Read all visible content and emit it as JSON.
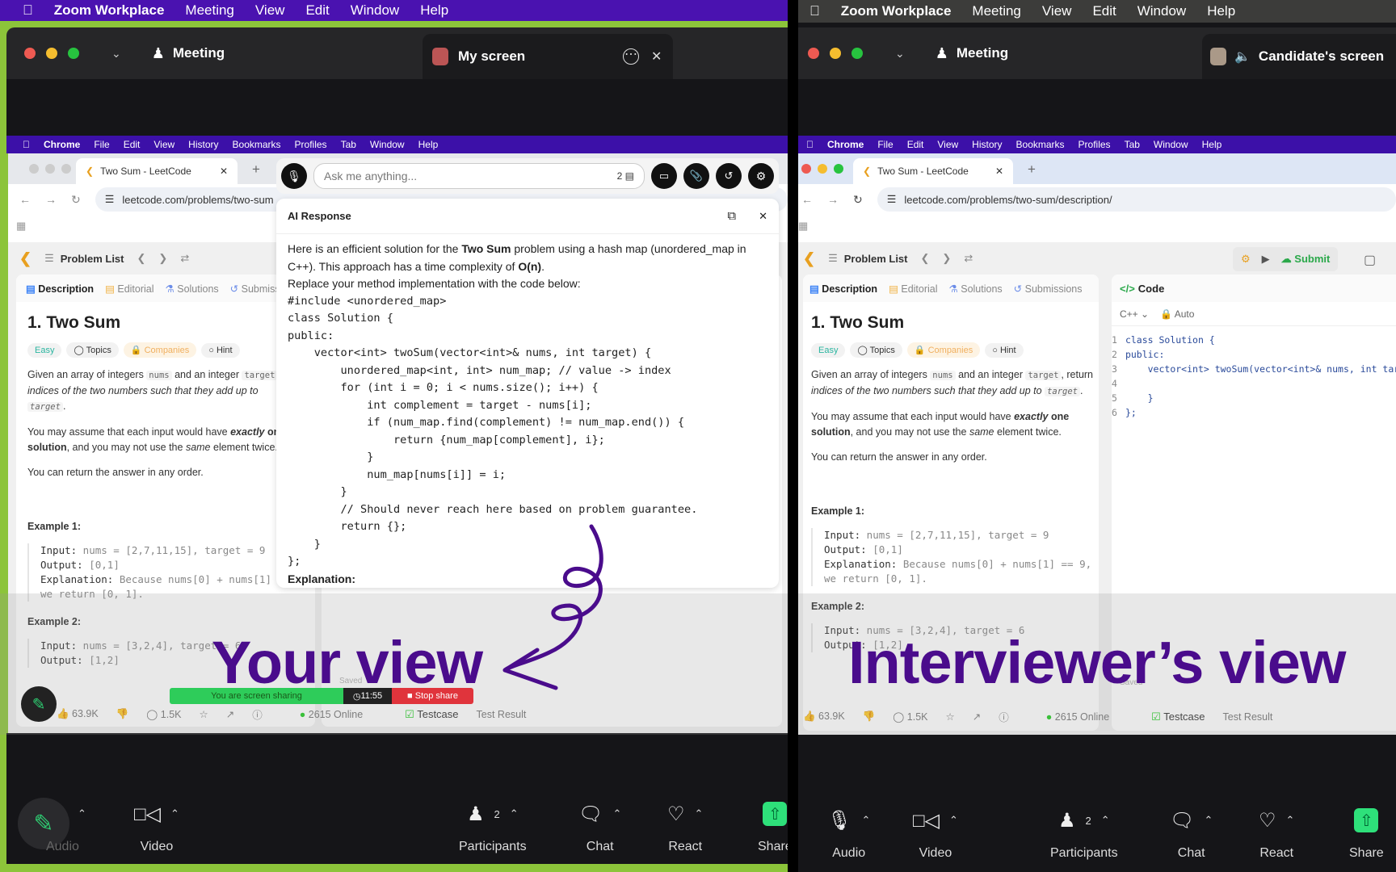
{
  "macbar": {
    "app": "Zoom Workplace",
    "items": [
      "Meeting",
      "View",
      "Edit",
      "Window",
      "Help"
    ]
  },
  "left": {
    "zoom_tab": "Meeting",
    "share_tab": "My screen",
    "chrome_menu": {
      "app": "Chrome",
      "items": [
        "File",
        "Edit",
        "View",
        "History",
        "Bookmarks",
        "Profiles",
        "Tab",
        "Window",
        "Help"
      ]
    },
    "browser_tab": "Two Sum - LeetCode",
    "url": "leetcode.com/problems/two-sum",
    "ai": {
      "placeholder": "Ask me anything...",
      "badge": "2",
      "title": "AI Response",
      "intro1_a": "Here is an efficient solution for the ",
      "intro1_b": "Two Sum",
      "intro1_c": " problem using a hash map (unordered_map in C++). This approach has a time complexity of ",
      "intro1_d": "O(n)",
      "intro1_e": ".",
      "intro2": "Replace your method implementation with the code below:",
      "code": "#include <unordered_map>\nclass Solution {\npublic:\n    vector<int> twoSum(vector<int>& nums, int target) {\n        unordered_map<int, int> num_map; // value -> index\n        for (int i = 0; i < nums.size(); i++) {\n            int complement = target - nums[i];\n            if (num_map.find(complement) != num_map.end()) {\n                return {num_map[complement], i};\n            }\n            num_map[nums[i]] = i;\n        }\n        // Should never reach here based on problem guarantee.\n        return {};\n    }\n};",
      "explanation": "Explanation:"
    },
    "sharing": {
      "text": "You are screen sharing",
      "timer": "11:55",
      "stop": "Stop share",
      "saved": "Saved"
    },
    "footer": {
      "likes": "63.9K",
      "comments": "1.5K",
      "online": "2615 Online",
      "testcase": "Testcase",
      "result": "Test Result"
    },
    "caption": "Your view"
  },
  "right": {
    "zoom_tab": "Meeting",
    "share_tab": "Candidate's screen",
    "browser_tab": "Two Sum - LeetCode",
    "url": "leetcode.com/problems/two-sum/description/",
    "submit": "Submit",
    "code_tab": "Code",
    "lang": "C++",
    "auto": "Auto",
    "code_lines": [
      "class Solution {",
      "public:",
      "    vector<int> twoSum(vector<int>& nums, int target) {",
      "",
      "    }",
      "};"
    ],
    "line_numbers": [
      "1",
      "2",
      "3",
      "4",
      "5",
      "6"
    ],
    "footer": {
      "likes": "63.9K",
      "comments": "1.5K",
      "online": "2615 Online",
      "testcase": "Testcase",
      "result": "Test Result"
    },
    "saved": "Saved",
    "caption": "Interviewer’s view"
  },
  "leetcode": {
    "problem_list": "Problem List",
    "tabs": [
      "Description",
      "Editorial",
      "Solutions",
      "Submissions"
    ],
    "title": "1. Two Sum",
    "tags": [
      "Easy",
      "Topics",
      "Companies",
      "Hint"
    ],
    "p1_a": "Given an array of integers ",
    "p1_code1": "nums",
    "p1_b": " and an integer ",
    "p1_code2": "target",
    "p1_c": ", return ",
    "p1_i": "indices of the two numbers such that they add up to",
    "p1_code3": "target",
    "p1_d": ".",
    "p2_a": "You may assume that each input would have ",
    "p2_b": "exactly one solution",
    "p2_c": ", and you may not use the ",
    "p2_d": "same",
    "p2_e": " element twice.",
    "p3": "You can return the answer in any order.",
    "ex1_title": "Example 1:",
    "ex1_input_label": "Input:",
    "ex1_input": " nums = [2,7,11,15], target = 9",
    "ex1_output_label": "Output:",
    "ex1_output": " [0,1]",
    "ex1_expl_label": "Explanation:",
    "ex1_expl": " Because nums[0] + nums[1] == 9,\nwe return [0, 1].",
    "ex2_title": "Example 2:",
    "ex2_input_label": "Input:",
    "ex2_input": " nums = [3,2,4], target = 6",
    "ex2_output_label": "Output:",
    "ex2_output": " [1,2]"
  },
  "toolbar": {
    "audio": "Audio",
    "video": "Video",
    "participants": "Participants",
    "participants_count": "2",
    "chat": "Chat",
    "react": "React",
    "share": "Share"
  },
  "colors": {
    "left_frame": "#8cc43a",
    "zoom_menubar_left": "#4a12b0",
    "chrome_menubar": "#3c10a8",
    "caption": "#4a0c8c",
    "share_green": "#2ecc5a",
    "stop_red": "#e0343c"
  }
}
